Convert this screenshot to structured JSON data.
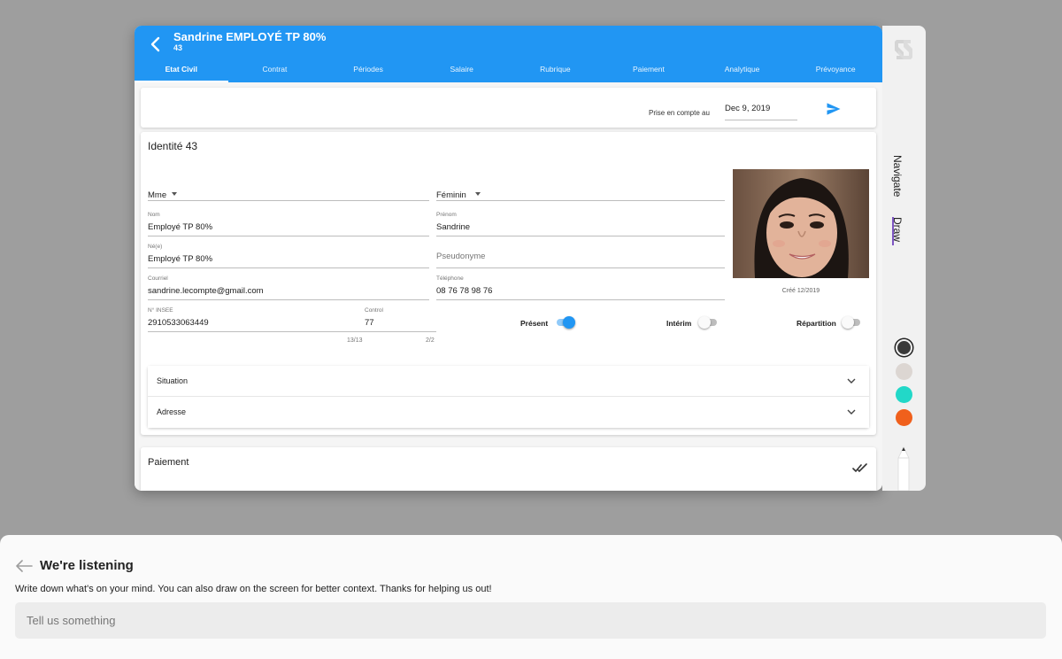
{
  "header": {
    "title": "Sandrine EMPLOYÉ TP 80%",
    "subtitle": "43",
    "tabs": [
      {
        "label": "Etat Civil"
      },
      {
        "label": "Contrat"
      },
      {
        "label": "Périodes"
      },
      {
        "label": "Salaire"
      },
      {
        "label": "Rubrique"
      },
      {
        "label": "Paiement"
      },
      {
        "label": "Analytique"
      },
      {
        "label": "Prévoyance"
      }
    ],
    "active_tab": "Etat Civil"
  },
  "date_panel": {
    "label": "Prise en compte au",
    "value": "Dec 9, 2019"
  },
  "identity": {
    "title": "Identité 43",
    "civility": "Mme",
    "gender": "Féminin",
    "nom": {
      "label": "Nom",
      "value": "Employé TP 80%"
    },
    "prenom": {
      "label": "Prénom",
      "value": "Sandrine"
    },
    "nee": {
      "label": "Né(e)",
      "value": "Employé TP 80%"
    },
    "pseudonyme": {
      "placeholder": "Pseudonyme"
    },
    "courriel": {
      "label": "Courriel",
      "value": "sandrine.lecompte@gmail.com"
    },
    "telephone": {
      "label": "Téléphone",
      "value": "08 76 78 98 76"
    },
    "insee": {
      "label": "N° INSEE",
      "value": "2910533063449",
      "counter": "13/13"
    },
    "control": {
      "label": "Control",
      "value": "77",
      "counter": "2/2"
    },
    "photo_caption": "Créé 12/2019",
    "switches": [
      {
        "label": "Présent",
        "on": true
      },
      {
        "label": "Intérim",
        "on": false
      },
      {
        "label": "Répartition",
        "on": false
      }
    ],
    "sections": [
      {
        "label": "Situation"
      },
      {
        "label": "Adresse"
      }
    ]
  },
  "payment": {
    "title": "Paiement"
  },
  "toolbar": {
    "tabs": [
      {
        "label": "Navigate"
      },
      {
        "label": "Draw"
      }
    ],
    "active_tab": "Draw",
    "colors": [
      "#3a3a3a",
      "#dcd6d2",
      "#22d8c8",
      "#f0601c"
    ],
    "selected_color": "#3a3a3a"
  },
  "feedback": {
    "title": "We're listening",
    "description": "Write down what's on your mind. You can also draw on the screen for better context. Thanks for helping us out!",
    "input_placeholder": "Tell us something"
  },
  "colors": {
    "primary": "#2196f3",
    "draw_indicator": "#7e57c2"
  }
}
